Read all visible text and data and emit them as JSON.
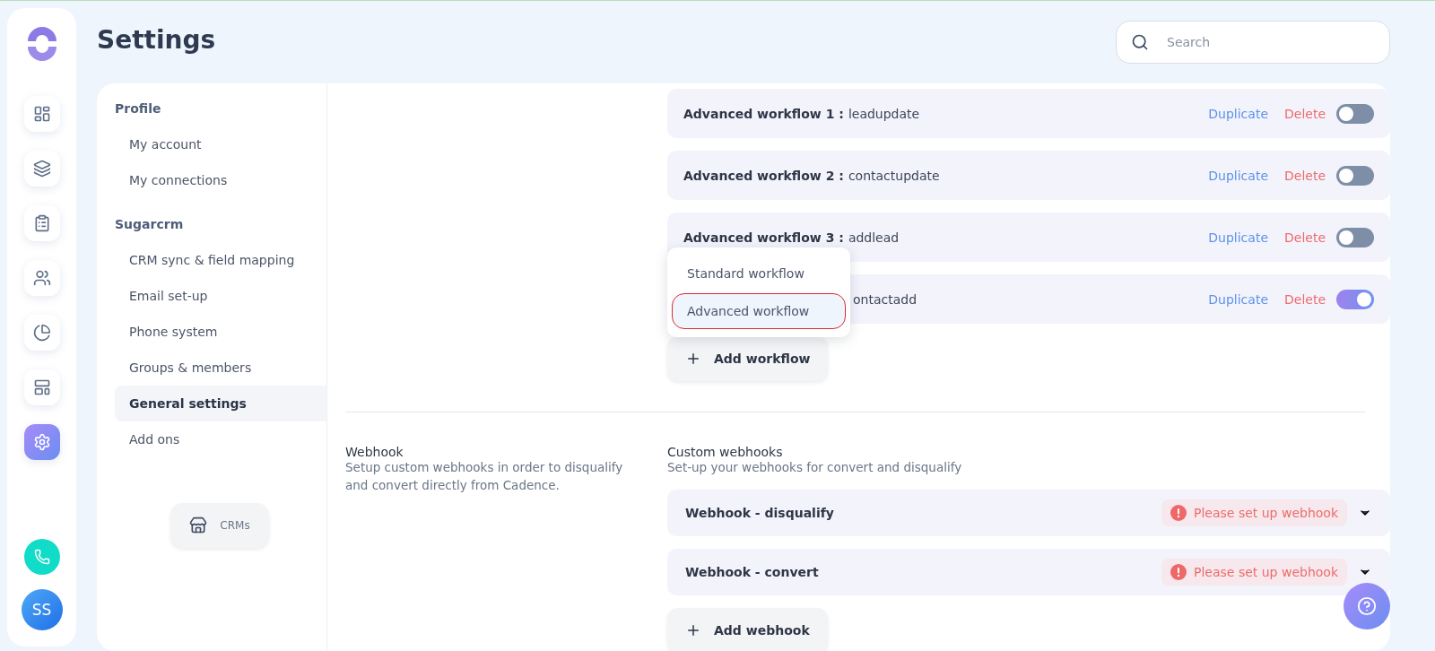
{
  "page": {
    "title": "Settings"
  },
  "search": {
    "placeholder": "Search"
  },
  "rail": [
    {
      "kind": "dashboard",
      "selected": false
    },
    {
      "kind": "stack",
      "selected": false
    },
    {
      "kind": "tasks",
      "selected": false
    },
    {
      "kind": "people",
      "selected": false
    },
    {
      "kind": "pie",
      "selected": false
    },
    {
      "kind": "layout",
      "selected": false
    },
    {
      "kind": "settings",
      "selected": true
    }
  ],
  "avatar": {
    "initials": "SS"
  },
  "menu": [
    {
      "heading": "Profile",
      "items": [
        {
          "label": "My account",
          "selected": false
        },
        {
          "label": "My connections",
          "selected": false
        }
      ]
    },
    {
      "heading": "Sugarcrm",
      "items": [
        {
          "label": "CRM sync & field mapping",
          "selected": false
        },
        {
          "label": "Email set-up",
          "selected": false
        },
        {
          "label": "Phone system",
          "selected": false
        },
        {
          "label": "Groups & members",
          "selected": false
        },
        {
          "label": "General settings",
          "selected": true
        },
        {
          "label": "Add ons",
          "selected": false
        }
      ]
    }
  ],
  "crms_button": {
    "label": "CRMs"
  },
  "workflows": [
    {
      "title": "Advanced workflow 1 :",
      "name": "leadupdate",
      "duplicate": "Duplicate",
      "delete": "Delete",
      "on": false
    },
    {
      "title": "Advanced workflow 2 :",
      "name": "contactupdate",
      "duplicate": "Duplicate",
      "delete": "Delete",
      "on": false
    },
    {
      "title": "Advanced workflow 3 :",
      "name": "addlead",
      "duplicate": "Duplicate",
      "delete": "Delete",
      "on": false
    },
    {
      "name": "ontactadd",
      "duplicate": "Duplicate",
      "delete": "Delete",
      "on": true
    }
  ],
  "workflow_menu": [
    {
      "label": "Standard workflow",
      "selected": false
    },
    {
      "label": "Advanced workflow",
      "selected": true
    }
  ],
  "add_workflow": {
    "label": "Add workflow"
  },
  "webhook_section": {
    "title": "Webhook",
    "description": "Setup custom webhooks in order to disqualify and convert directly from Cadence.",
    "heading": "Custom webhooks",
    "subheading": "Set-up your webhooks for convert and disqualify"
  },
  "webhooks": [
    {
      "name": "Webhook - disqualify",
      "status": "Please set up webhook"
    },
    {
      "name": "Webhook - convert",
      "status": "Please set up webhook"
    }
  ],
  "add_webhook": {
    "label": "Add webhook"
  }
}
